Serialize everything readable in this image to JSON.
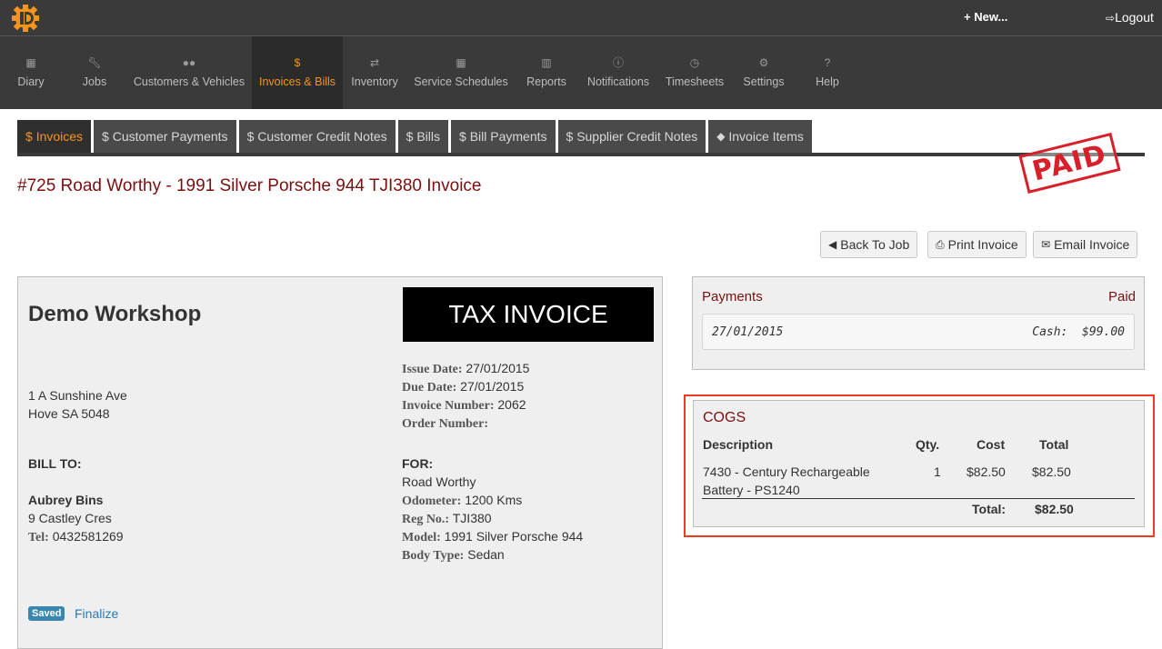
{
  "topbar": {
    "new_label": "New...",
    "logout_label": "Logout"
  },
  "nav": [
    {
      "label": "Diary",
      "icon": "calendar-icon"
    },
    {
      "label": "Jobs",
      "icon": "wrench-icon"
    },
    {
      "label": "Customers & Vehicles",
      "icon": "users-icon"
    },
    {
      "label": "Invoices & Bills",
      "icon": "dollar-icon",
      "active": true
    },
    {
      "label": "Inventory",
      "icon": "retweet-icon"
    },
    {
      "label": "Service Schedules",
      "icon": "calendar-icon"
    },
    {
      "label": "Reports",
      "icon": "bar-chart-icon"
    },
    {
      "label": "Notifications",
      "icon": "info-icon"
    },
    {
      "label": "Timesheets",
      "icon": "clock-icon"
    },
    {
      "label": "Settings",
      "icon": "gears-icon"
    },
    {
      "label": "Help",
      "icon": "question-icon"
    }
  ],
  "subtabs": [
    {
      "label": "Invoices",
      "icon": "$",
      "active": true
    },
    {
      "label": "Customer Payments",
      "icon": "$"
    },
    {
      "label": "Customer Credit Notes",
      "icon": "$"
    },
    {
      "label": "Bills",
      "icon": "$"
    },
    {
      "label": "Bill Payments",
      "icon": "$"
    },
    {
      "label": "Supplier Credit Notes",
      "icon": "$"
    },
    {
      "label": "Invoice Items",
      "icon": "tag-icon"
    }
  ],
  "page": {
    "title": "#725 Road Worthy - 1991 Silver Porsche 944 TJI380 Invoice",
    "stamp": "PAID"
  },
  "actions": {
    "back": "Back To Job",
    "print": "Print Invoice",
    "email": "Email Invoice"
  },
  "invoice": {
    "workshop": "Demo Workshop",
    "doc_type": "TAX INVOICE",
    "address_line1": "1 A Sunshine Ave",
    "address_line2": "Hove SA 5048",
    "bill_to_label": "BILL TO:",
    "customer_name": "Aubrey Bins",
    "customer_address": "9 Castley Cres",
    "tel_label": "Tel:",
    "tel": "0432581269",
    "issue_date_label": "Issue Date:",
    "issue_date": "27/01/2015",
    "due_date_label": "Due Date:",
    "due_date": "27/01/2015",
    "invoice_number_label": "Invoice Number:",
    "invoice_number": "2062",
    "order_number_label": "Order Number:",
    "order_number": "",
    "for_label": "FOR:",
    "for_value": "Road Worthy",
    "odometer_label": "Odometer:",
    "odometer": "1200 Kms",
    "reg_label": "Reg No.:",
    "reg": "TJI380",
    "model_label": "Model:",
    "model": "1991 Silver Porsche 944",
    "body_label": "Body Type:",
    "body": "Sedan",
    "status_badge": "Saved",
    "finalize_label": "Finalize"
  },
  "payments": {
    "title": "Payments",
    "status": "Paid",
    "rows": [
      {
        "date": "27/01/2015",
        "method_amount": "Cash:  $99.00"
      }
    ]
  },
  "cogs": {
    "title": "COGS",
    "headers": {
      "description": "Description",
      "qty": "Qty.",
      "cost": "Cost",
      "total": "Total"
    },
    "rows": [
      {
        "description_line1": "7430 - Century Rechargeable",
        "description_line2": "Battery - PS1240",
        "qty": "1",
        "cost": "$82.50",
        "total": "$82.50"
      }
    ],
    "total_label": "Total:",
    "total_value": "$82.50"
  },
  "colors": {
    "accent": "#f7941d",
    "title_red": "#7a0f0f",
    "highlight": "#ee3b1f",
    "stamp": "#d9202a"
  }
}
